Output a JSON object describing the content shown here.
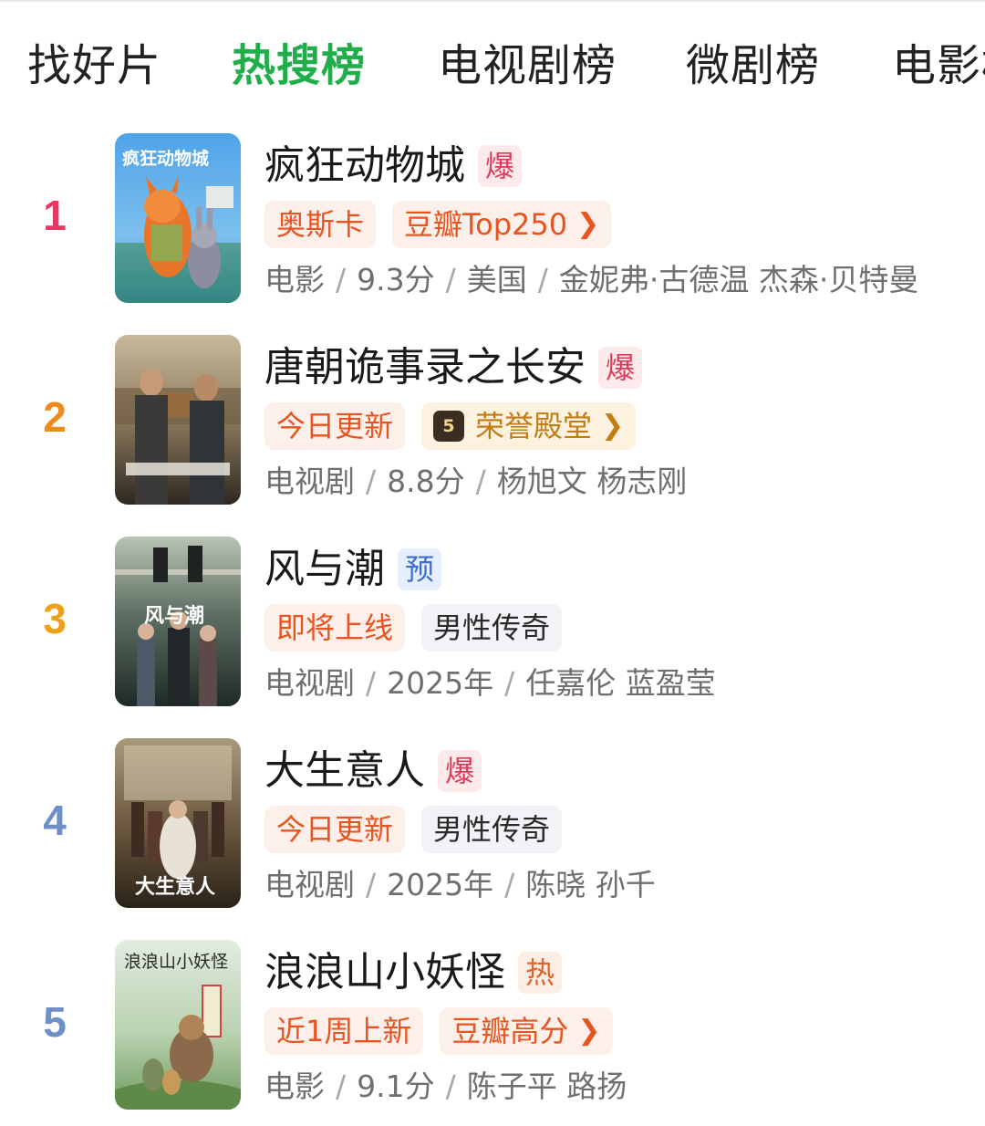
{
  "tabs": [
    {
      "label": "找好片",
      "active": false
    },
    {
      "label": "热搜榜",
      "active": true
    },
    {
      "label": "电视剧榜",
      "active": false
    },
    {
      "label": "微剧榜",
      "active": false
    },
    {
      "label": "电影榜",
      "active": false
    }
  ],
  "colors": {
    "accent_green": "#1fae4a",
    "rank_colors": [
      "#e63a64",
      "#ef8b1c",
      "#eea017",
      "#6f8fc9",
      "#6f8fc9"
    ]
  },
  "items": [
    {
      "rank": "1",
      "title": "疯狂动物城",
      "flag": "爆",
      "flag_type": "hot",
      "tags": [
        {
          "label": "奥斯卡",
          "style": "orange"
        },
        {
          "label": "豆瓣Top250",
          "style": "orange",
          "chevron": true
        }
      ],
      "meta": [
        "电影",
        "9.3分",
        "美国",
        "金妮弗·古德温 杰森·贝特曼"
      ],
      "poster_text": "疯狂动物城",
      "poster_icon": "zootopia-poster"
    },
    {
      "rank": "2",
      "title": "唐朝诡事录之长安",
      "flag": "爆",
      "flag_type": "hot",
      "tags": [
        {
          "label": "今日更新",
          "style": "orange"
        },
        {
          "label": "荣誉殿堂",
          "style": "gold",
          "chevron": true,
          "badge": "5"
        }
      ],
      "meta": [
        "电视剧",
        "8.8分",
        "杨旭文 杨志刚"
      ],
      "poster_text": "",
      "poster_icon": "tang-poster"
    },
    {
      "rank": "3",
      "title": "风与潮",
      "flag": "预",
      "flag_type": "pre",
      "tags": [
        {
          "label": "即将上线",
          "style": "orange"
        },
        {
          "label": "男性传奇",
          "style": "gray"
        }
      ],
      "meta": [
        "电视剧",
        "2025年",
        "任嘉伦 蓝盈莹"
      ],
      "poster_text": "风与潮",
      "poster_icon": "fengyuchao-poster"
    },
    {
      "rank": "4",
      "title": "大生意人",
      "flag": "爆",
      "flag_type": "hot",
      "tags": [
        {
          "label": "今日更新",
          "style": "orange"
        },
        {
          "label": "男性传奇",
          "style": "gray"
        }
      ],
      "meta": [
        "电视剧",
        "2025年",
        "陈晓 孙千"
      ],
      "poster_text": "大生意人",
      "poster_icon": "dashengyiren-poster"
    },
    {
      "rank": "5",
      "title": "浪浪山小妖怪",
      "flag": "热",
      "flag_type": "warm",
      "tags": [
        {
          "label": "近1周上新",
          "style": "orange"
        },
        {
          "label": "豆瓣高分",
          "style": "orange",
          "chevron": true
        }
      ],
      "meta": [
        "电影",
        "9.1分",
        "陈子平 路扬"
      ],
      "poster_text": "浪浪山小妖怪",
      "poster_icon": "langlangshan-poster"
    }
  ]
}
